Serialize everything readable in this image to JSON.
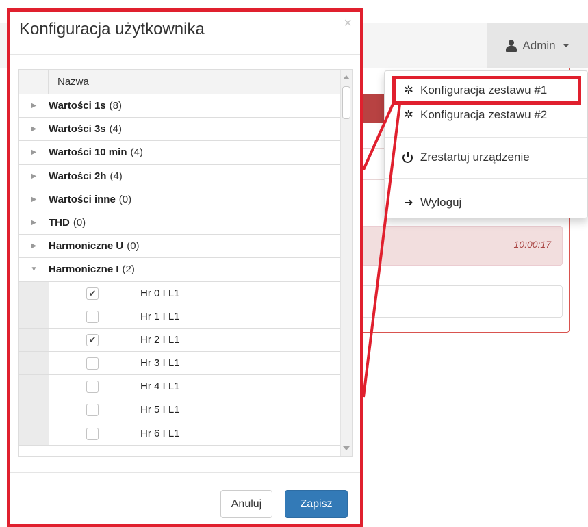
{
  "navbar": {
    "user_label": "Admin"
  },
  "background": {
    "timestamp": "10:00:17"
  },
  "user_menu": {
    "items": [
      {
        "label": "Konfiguracja zestawu #1",
        "icon": "gear-icon"
      },
      {
        "label": "Konfiguracja zestawu #2",
        "icon": "gear-icon"
      },
      {
        "label": "Zrestartuj urządzenie",
        "icon": "power-icon"
      },
      {
        "label": "Wyloguj",
        "icon": "sign-out-icon"
      }
    ]
  },
  "modal": {
    "title": "Konfiguracja użytkownika",
    "close_glyph": "×",
    "grid": {
      "column_header": "Nazwa",
      "groups": [
        {
          "label": "Wartości 1s",
          "count": "(8)",
          "expanded": false
        },
        {
          "label": "Wartości 3s",
          "count": "(4)",
          "expanded": false
        },
        {
          "label": "Wartości 10 min",
          "count": "(4)",
          "expanded": false
        },
        {
          "label": "Wartości 2h",
          "count": "(4)",
          "expanded": false
        },
        {
          "label": "Wartości inne",
          "count": "(0)",
          "expanded": false
        },
        {
          "label": "THD",
          "count": "(0)",
          "expanded": false
        },
        {
          "label": "Harmoniczne U",
          "count": "(0)",
          "expanded": false
        },
        {
          "label": "Harmoniczne I",
          "count": "(2)",
          "expanded": true
        }
      ],
      "items": [
        {
          "name": "Hr 0 I L1",
          "checked": true
        },
        {
          "name": "Hr 1 I L1",
          "checked": false
        },
        {
          "name": "Hr 2 I L1",
          "checked": true
        },
        {
          "name": "Hr 3 I L1",
          "checked": false
        },
        {
          "name": "Hr 4 I L1",
          "checked": false
        },
        {
          "name": "Hr 5 I L1",
          "checked": false
        },
        {
          "name": "Hr 6 I L1",
          "checked": false
        }
      ]
    },
    "footer": {
      "cancel_label": "Anuluj",
      "save_label": "Zapisz"
    }
  },
  "colors": {
    "annotation_red": "#e0202e",
    "primary_blue": "#337ab7",
    "danger_heading": "#b84242"
  }
}
